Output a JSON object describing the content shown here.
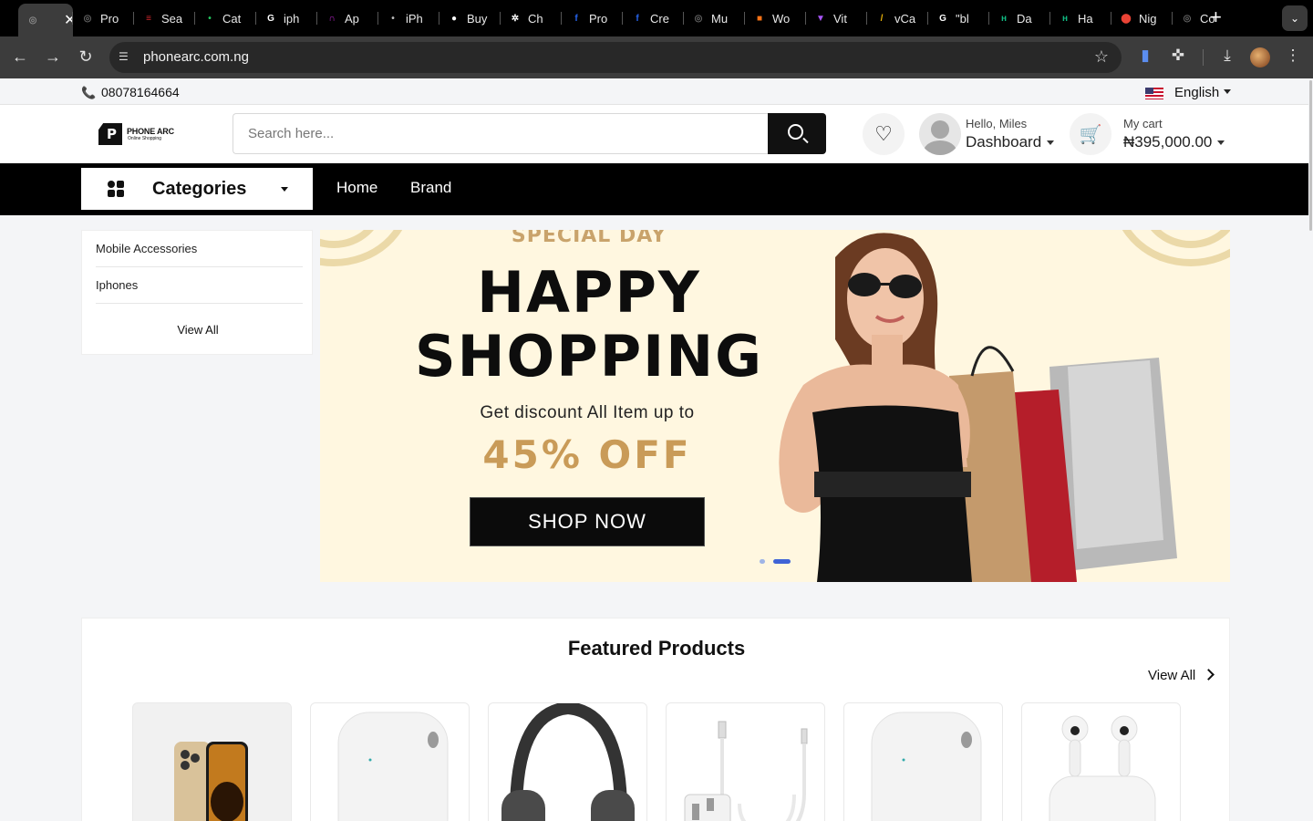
{
  "browser": {
    "tabs": [
      {
        "label": "",
        "favicon": "globe-icon",
        "color": "#8a8a8a",
        "active": true
      },
      {
        "label": "Pro",
        "favicon": "globe-icon",
        "color": "#666666"
      },
      {
        "label": "Sea",
        "favicon": "flag-stripes-icon",
        "color": "#d4262c"
      },
      {
        "label": "Cat",
        "favicon": "green-dot-icon",
        "color": "#22c55e"
      },
      {
        "label": "iph",
        "favicon": "google-icon",
        "color": "#ffffff"
      },
      {
        "label": "Ap",
        "favicon": "arch-icon",
        "color": "#c026d3"
      },
      {
        "label": "iPh",
        "favicon": "apple-icon",
        "color": "#bbbbbb"
      },
      {
        "label": "Buy",
        "favicon": "circle-logo-icon",
        "color": "#ffffff"
      },
      {
        "label": "Ch",
        "favicon": "chatgpt-icon",
        "color": "#ffffff"
      },
      {
        "label": "Pro",
        "favicon": "f-logo-icon",
        "color": "#2563eb"
      },
      {
        "label": "Cre",
        "favicon": "f-logo-icon",
        "color": "#2563eb"
      },
      {
        "label": "Mu",
        "favicon": "globe-icon",
        "color": "#666666"
      },
      {
        "label": "Wo",
        "favicon": "cubes-icon",
        "color": "#f97316"
      },
      {
        "label": "Vit",
        "favicon": "vite-icon",
        "color": "#a855f7"
      },
      {
        "label": "vCa",
        "favicon": "pen-icon",
        "color": "#eab308"
      },
      {
        "label": "\"bl",
        "favicon": "google-icon",
        "color": "#ffffff"
      },
      {
        "label": "Da",
        "favicon": "hh-icon",
        "color": "#10b981"
      },
      {
        "label": "Ha",
        "favicon": "hh-icon",
        "color": "#10b981"
      },
      {
        "label": "Nig",
        "favicon": "maps-pin-icon",
        "color": "#ea4335"
      },
      {
        "label": "Co",
        "favicon": "globe-icon",
        "color": "#666666"
      }
    ],
    "url": "phonearc.com.ng"
  },
  "topbar": {
    "phone": "08078164664",
    "language": "English"
  },
  "header": {
    "logo_title": "PHONE ARC",
    "logo_subtitle": "Online Shopping",
    "search_placeholder": "Search here...",
    "greeting": "Hello, Miles",
    "dashboard_label": "Dashboard",
    "cart_label": "My cart",
    "cart_total": "₦395,000.00"
  },
  "nav": {
    "categories_label": "Categories",
    "links": [
      "Home",
      "Brand"
    ]
  },
  "sidebar": {
    "items": [
      "Mobile Accessories",
      "Iphones"
    ],
    "view_all": "View All"
  },
  "banner": {
    "special": "SPECIAL DAY",
    "line1": "HAPPY",
    "line2": "SHOPPING",
    "discount": "Get discount All Item up to",
    "offer": "45% OFF",
    "cta": "SHOP NOW",
    "active_slide": 2,
    "slide_count": 2,
    "accent": "#c99b58"
  },
  "featured": {
    "title": "Featured Products",
    "view_all": "View All",
    "products": [
      {
        "image": "iphone-14-pro-gold"
      },
      {
        "image": "airpods-pro-case"
      },
      {
        "image": "airpods-max"
      },
      {
        "image": "usb-c-charger-cable"
      },
      {
        "image": "airpods-pro-case"
      },
      {
        "image": "airpods-3rd-gen"
      }
    ]
  }
}
